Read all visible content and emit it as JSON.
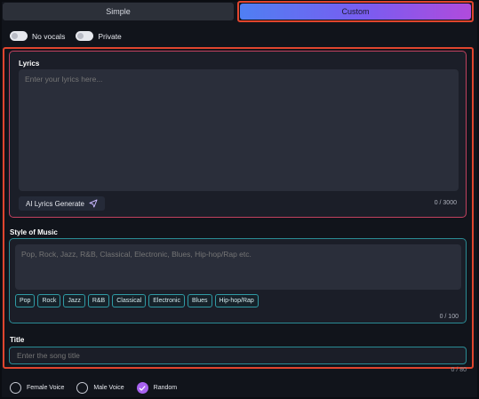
{
  "tabs": {
    "simple": "Simple",
    "custom": "Custom"
  },
  "toggles": {
    "no_vocals": "No vocals",
    "private": "Private"
  },
  "lyrics": {
    "label": "Lyrics",
    "placeholder": "Enter your lyrics here...",
    "ai_button": "AI Lyrics Generate",
    "count": "0 / 3000"
  },
  "style": {
    "label": "Style of Music",
    "placeholder": "Pop, Rock, Jazz, R&B, Classical, Electronic, Blues, Hip-hop/Rap etc.",
    "tags": [
      "Pop",
      "Rock",
      "Jazz",
      "R&B",
      "Classical",
      "Electronic",
      "Blues",
      "Hip-hop/Rap"
    ],
    "count": "0 / 100"
  },
  "title": {
    "label": "Title",
    "placeholder": "Enter the song title",
    "count": "0 / 80"
  },
  "voices": {
    "female": "Female Voice",
    "male": "Male Voice",
    "random": "Random",
    "selected": "Random"
  },
  "colors": {
    "accent_red": "#e0452e",
    "teal": "#2a8b94",
    "purple": "#a862f0"
  }
}
